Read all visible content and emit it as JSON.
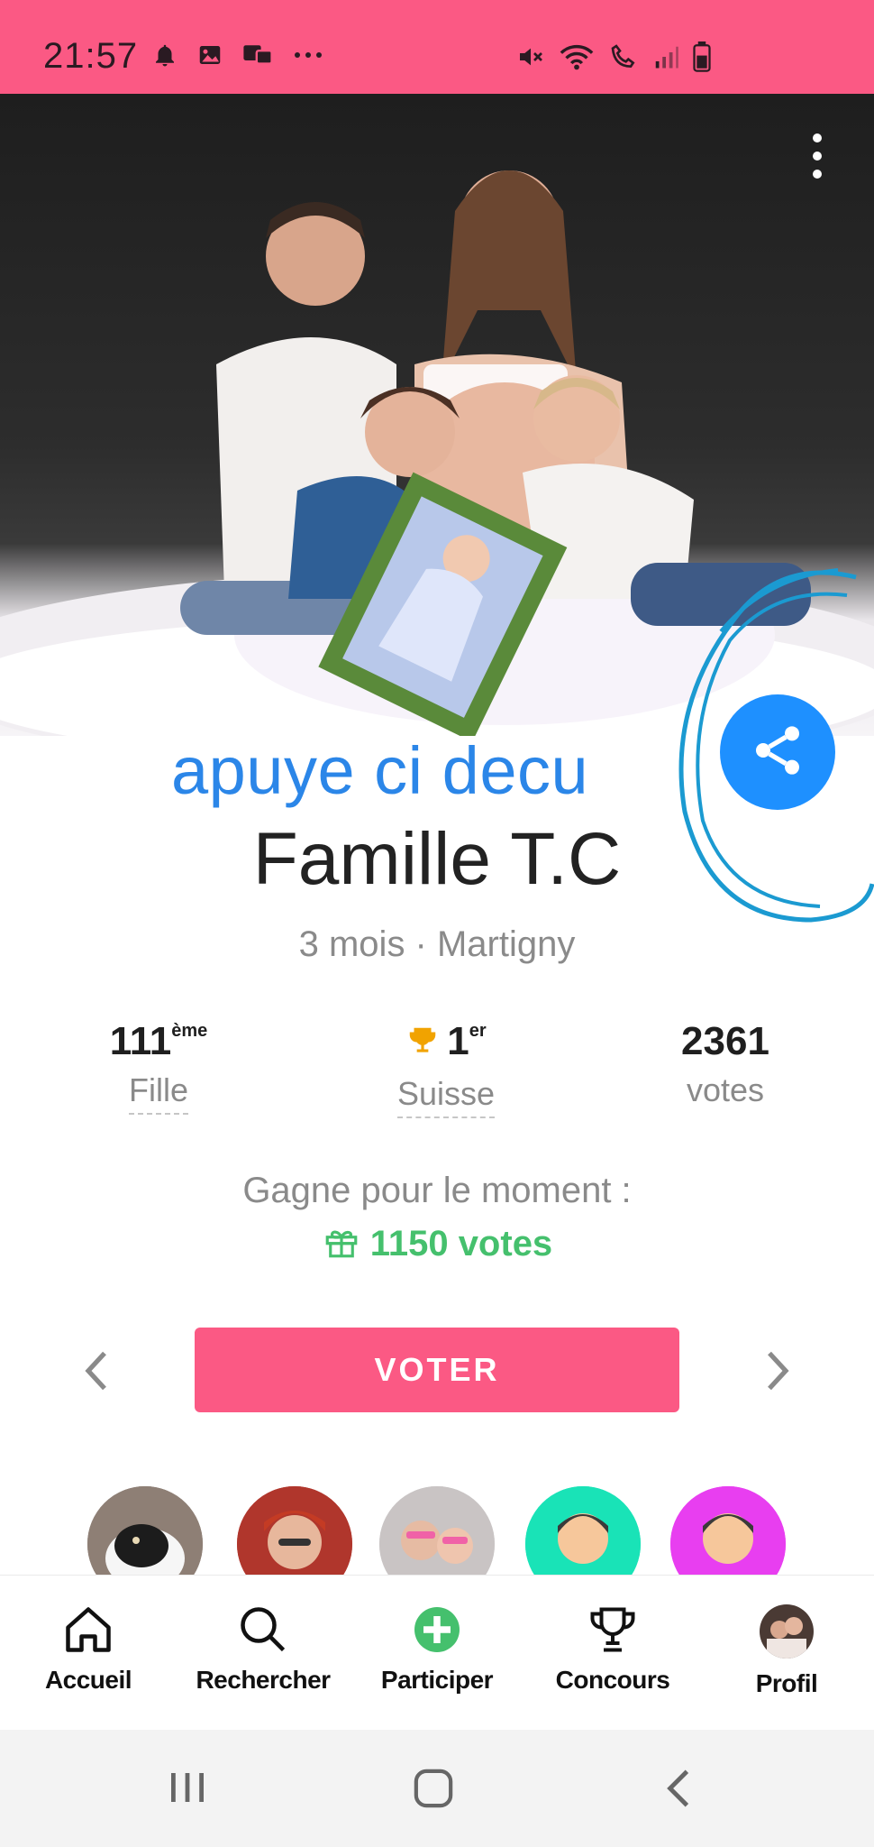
{
  "status_bar": {
    "time": "21:57",
    "left_icons": [
      "bell-icon",
      "image-icon",
      "message-icon",
      "more-dots-icon"
    ],
    "right_icons": [
      "mute-icon",
      "wifi-icon",
      "call-icon",
      "signal-icon",
      "battery-icon"
    ]
  },
  "profile": {
    "overlay_text": "apuye ci decu",
    "name": "Famille T.C",
    "meta": "3 mois · Martigny"
  },
  "stats": [
    {
      "value": "111",
      "sup": "ème",
      "label": "Fille"
    },
    {
      "value": "1",
      "sup": "er",
      "label": "Suisse",
      "icon": "trophy-icon"
    },
    {
      "value": "2361",
      "sup": "",
      "label": "votes"
    }
  ],
  "gain": {
    "label": "Gagne pour le moment :",
    "value": "1150 votes"
  },
  "vote_button": {
    "label": "VOTER"
  },
  "bottom_nav": [
    {
      "label": "Accueil",
      "icon": "home-icon"
    },
    {
      "label": "Rechercher",
      "icon": "search-icon"
    },
    {
      "label": "Participer",
      "icon": "add-circle-icon"
    },
    {
      "label": "Concours",
      "icon": "trophy-icon"
    },
    {
      "label": "Profil",
      "icon": "profile-photo-icon"
    }
  ],
  "colors": {
    "brand_pink": "#fb5984",
    "share_blue": "#1e90ff",
    "text_blue": "#2b86e8",
    "gain_green": "#45c06d",
    "trophy_gold": "#f1a300",
    "avatar_teal": "#19e3b7",
    "avatar_magenta": "#e83ef0"
  }
}
